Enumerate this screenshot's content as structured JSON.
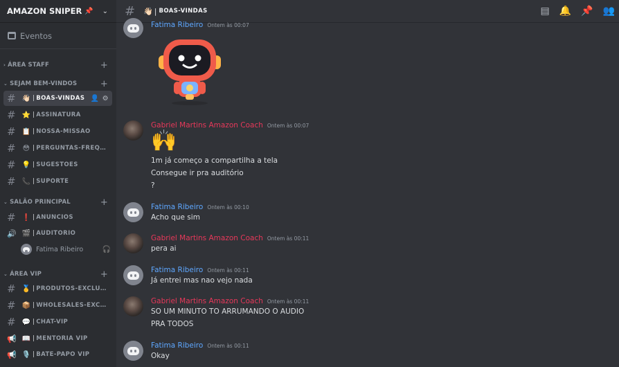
{
  "server": {
    "name": "AMAZON SNIPER",
    "events_label": "Eventos"
  },
  "categories": [
    {
      "label": "ÁREA STAFF"
    },
    {
      "label": "SEJAM BEM-VINDOS"
    },
    {
      "label": "SALÃO PRINCIPAL"
    },
    {
      "label": "ÁREA VIP"
    }
  ],
  "channels": [
    {
      "emoji": "👋🏻",
      "name": "BOAS-VINDAS"
    },
    {
      "emoji": "⭐",
      "name": "ASSINATURA"
    },
    {
      "emoji": "📋",
      "name": "NOSSA-MISSÃO"
    },
    {
      "emoji": "😳",
      "name": "PERGUNTAS-FREQUENT..."
    },
    {
      "emoji": "💡",
      "name": "SUGESTÕES"
    },
    {
      "emoji": "📞",
      "name": "SUPORTE"
    },
    {
      "emoji": "❗",
      "name": "ANÚNCIOS"
    },
    {
      "emoji": "🎬",
      "name": "AUDITÓRIO"
    },
    {
      "emoji": "🥇",
      "name": "PRODUTOS-EXCLUSIVOS"
    },
    {
      "emoji": "📦",
      "name": "WHOLESALES-EXCLUSI..."
    },
    {
      "emoji": "💬",
      "name": "CHAT-VIP"
    },
    {
      "emoji": "📖",
      "name": "MENTORIA VIP"
    },
    {
      "emoji": "🎙️",
      "name": "BATE-PAPO VIP"
    }
  ],
  "voice_user": {
    "name": "Fatima Ribeiro"
  },
  "header": {
    "emoji": "👋🏻",
    "channel_title": "BOAS-VINDAS"
  },
  "messages": [
    {
      "author": "Fatima Ribeiro",
      "time": "Ontem às 00:07",
      "lines": []
    },
    {
      "author": "Gabriel Martins Amazon Coach",
      "time": "Ontem às 00:07",
      "emoji": "🙌",
      "lines": [
        "1m já começo a compartilha a tela",
        "Consegue ir pra auditório",
        "?"
      ]
    },
    {
      "author": "Fatima Ribeiro",
      "time": "Ontem às 00:10",
      "lines": [
        "Acho que sim"
      ]
    },
    {
      "author": "Gabriel Martins Amazon Coach",
      "time": "Ontem às 00:11",
      "lines": [
        "pera ai"
      ]
    },
    {
      "author": "Fatima Ribeiro",
      "time": "Ontem às 00:11",
      "lines": [
        "Já entrei mas nao vejo nada"
      ]
    },
    {
      "author": "Gabriel Martins Amazon Coach",
      "time": "Ontem às 00:11",
      "lines": [
        "SO UM MINUTO TO ARRUMANDO O AUDIO",
        "PRA TODOS"
      ]
    },
    {
      "author": "Fatima Ribeiro",
      "time": "Ontem às 00:11",
      "lines": [
        "Okay"
      ]
    }
  ],
  "colors": {
    "author_blue": "#5ea7ff",
    "author_red": "#e8385a",
    "background": "#313338",
    "sidebar": "#2b2d31"
  }
}
